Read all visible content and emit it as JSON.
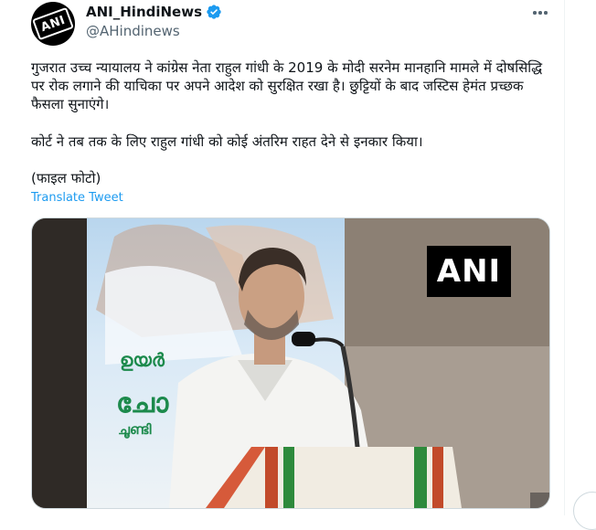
{
  "tweet": {
    "display_name": "ANI_HindiNews",
    "handle": "@AHindinews",
    "avatar_text": "ANI",
    "paragraph1": "गुजरात उच्च न्यायालय ने कांग्रेस नेता राहुल गांधी के 2019 के मोदी सरनेम मानहानि मामले में दोषसिद्धि पर रोक लगाने की याचिका पर अपने आदेश को सुरक्षित रखा है। छुट्टियों के बाद जस्टिस हेमंत प्रच्छक फैसला सुनाएंगे।",
    "paragraph2": "कोर्ट ने तब तक के लिए राहुल गांधी को कोई अंतरिम राहत देने से इनकार किया।",
    "paragraph3": "(फाइल फोटो)",
    "translate_label": "Translate Tweet",
    "media": {
      "watermark": "ANI",
      "banner_text_lines": [
        "ഉയർ",
        "ചോ",
        "ചൂണ്ടി"
      ]
    }
  },
  "icons": {
    "verified": "verified-badge-icon",
    "more": "more-options-icon"
  },
  "colors": {
    "link": "#1d9bf0",
    "secondary_text": "#536471",
    "verified": "#1d9bf0"
  }
}
